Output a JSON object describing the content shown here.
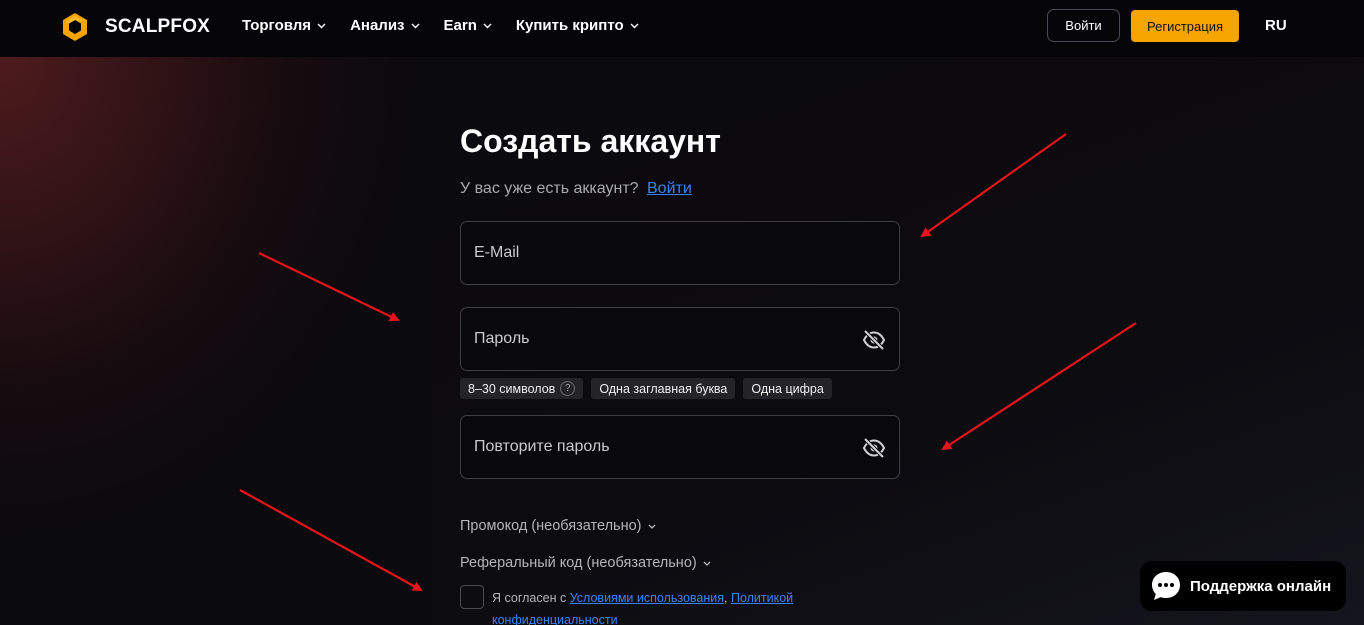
{
  "header": {
    "logo_text": "SCALPFOX",
    "nav": [
      {
        "label": "Торговля"
      },
      {
        "label": "Анализ"
      },
      {
        "label": "Earn"
      },
      {
        "label": "Купить крипто"
      }
    ],
    "login_label": "Войти",
    "register_label": "Регистрация",
    "language": "RU"
  },
  "form": {
    "title": "Создать аккаунт",
    "have_account": "У вас уже есть аккаунт?",
    "login_link": "Войти",
    "email_placeholder": "E-Mail",
    "password_placeholder": "Пароль",
    "password_hints": [
      "8–30 символов",
      "Одна заглавная буква",
      "Одна цифра"
    ],
    "hint_help_glyph": "?",
    "repeat_password_placeholder": "Повторите пароль",
    "promo_label": "Промокод (необязательно)",
    "referral_label": "Реферальный код (необязательно)",
    "agree_prefix": "Я согласен с ",
    "terms_link": "Условиями использования",
    "agree_separator": ", ",
    "privacy_link": "Политикой конфиденциальности"
  },
  "support": {
    "label": "Поддержка онлайн"
  },
  "colors": {
    "accent": "#f5a400",
    "link": "#3b82f6",
    "annotation_arrow": "#e8141c"
  },
  "icons": [
    "logo-hexagon-icon",
    "chevron-down-icon",
    "eye-slash-icon",
    "help-circle-icon",
    "chat-bubble-icon"
  ]
}
